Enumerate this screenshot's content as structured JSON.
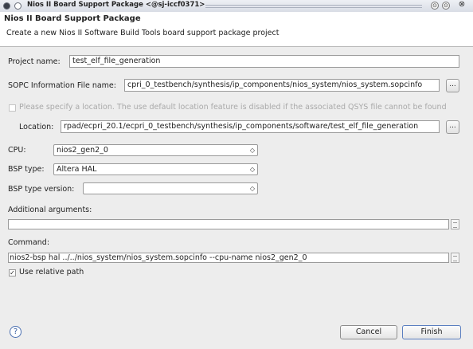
{
  "window": {
    "title": "Nios II Board Support Package  <@sj-iccf0371>",
    "controls": {
      "minimize_icon": "⊙",
      "maximize_icon": "⊙",
      "close_icon": "⊗"
    }
  },
  "header": {
    "title": "Nios II Board Support Package",
    "subtitle": "Create a new Nios II Software Build Tools board support package project"
  },
  "form": {
    "project_name": {
      "label": "Project name:",
      "value": "test_elf_file_generation"
    },
    "sopc": {
      "label": "SOPC Information File name:",
      "value": "cpri_0_testbench/synthesis/ip_components/nios_system/nios_system.sopcinfo",
      "browse": "..."
    },
    "location_check": {
      "label": "Please specify a location.  The use default location feature is disabled if the associated QSYS file cannot be found"
    },
    "location": {
      "label": "Location:",
      "value": "rpad/ecpri_20.1/ecpri_0_testbench/synthesis/ip_components/software/test_elf_file_generation",
      "browse": "..."
    },
    "cpu": {
      "label": "CPU:",
      "value": "nios2_gen2_0"
    },
    "bsp_type": {
      "label": "BSP type:",
      "value": "Altera HAL"
    },
    "bsp_version": {
      "label": "BSP type version:",
      "value": ""
    },
    "additional_args": {
      "label": "Additional arguments:",
      "value": ""
    },
    "command": {
      "label": "Command:",
      "value": "nios2-bsp hal ../../nios_system/nios_system.sopcinfo --cpu-name nios2_gen2_0"
    },
    "relative_path": {
      "label": "Use relative path",
      "checked": true,
      "check_glyph": "✓"
    },
    "spin_glyph": "◇"
  },
  "footer": {
    "help": "?",
    "cancel": "Cancel",
    "finish": "Finish"
  }
}
